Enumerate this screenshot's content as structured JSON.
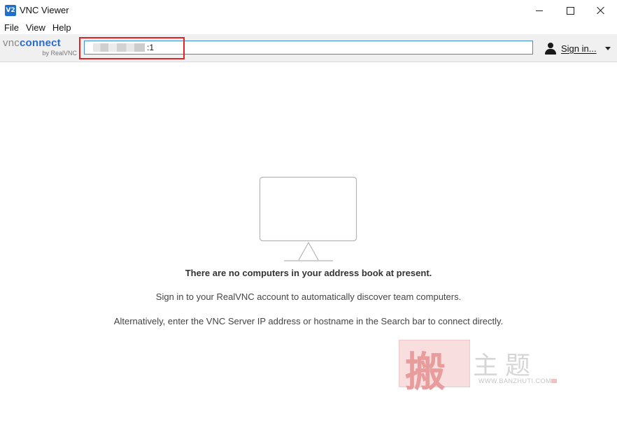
{
  "window": {
    "title": "VNC Viewer",
    "app_icon_text": "V2"
  },
  "menu": {
    "items": [
      {
        "label": "File"
      },
      {
        "label": "View"
      },
      {
        "label": "Help"
      }
    ]
  },
  "toolbar": {
    "logo": {
      "primary_a": "vnc",
      "primary_b": "connect",
      "secondary": "by RealVNC"
    },
    "search": {
      "value_suffix": ":1"
    },
    "sign_in_label": "Sign in..."
  },
  "empty_state": {
    "headline": "There are no computers in your address book at present.",
    "line1": "Sign in to your RealVNC account to automatically discover team computers.",
    "line2": "Alternatively, enter the VNC Server IP address or hostname in the Search bar to connect directly."
  },
  "watermark": {
    "char": "搬",
    "text": "主题",
    "url": "WWW.BANZHUTI.COM"
  },
  "colors": {
    "accent": "#2a6bd3",
    "search_border": "#3d8fd1",
    "highlight": "#e02424"
  }
}
